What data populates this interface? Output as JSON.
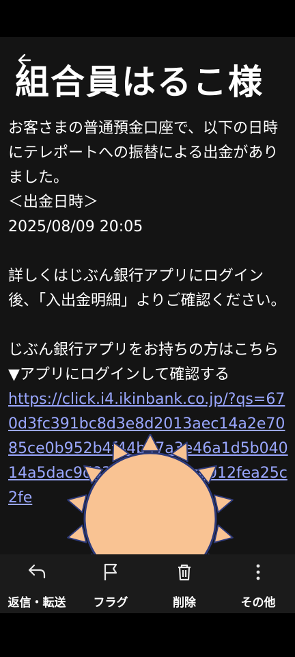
{
  "email": {
    "title": "組合員はるこ様",
    "body_lines": [
      "お客さまの普通預金口座で、以下の日時にテレポートへの振替による出金がありました。",
      "＜出金日時＞",
      "2025/08/09 20:05",
      "",
      "詳しくはじぶん銀行アプリにログイン後、「入出金明細」よりご確認ください。",
      "",
      "じぶん銀行アプリをお持ちの方はこちら",
      "▼アプリにログインして確認する"
    ],
    "link_text": "https://click.i4.ikinbank.co.jp/?qs=670d3fc391bc8d3e8d2013aec14a2e7085ce0b952b4f44b47a3e46a1d5b04014a5dac9d83b2cf3c72ace012fea25c2fe"
  },
  "actions": [
    {
      "label": "返信・転送",
      "icon": "reply-icon"
    },
    {
      "label": "フラグ",
      "icon": "flag-icon"
    },
    {
      "label": "削除",
      "icon": "trash-icon"
    },
    {
      "label": "その他",
      "icon": "more-vertical-icon"
    }
  ],
  "colors": {
    "background": "#141414",
    "link": "#9aa7ff",
    "sun_fill": "#f9c393",
    "sun_outline": "#2d3a7a"
  }
}
